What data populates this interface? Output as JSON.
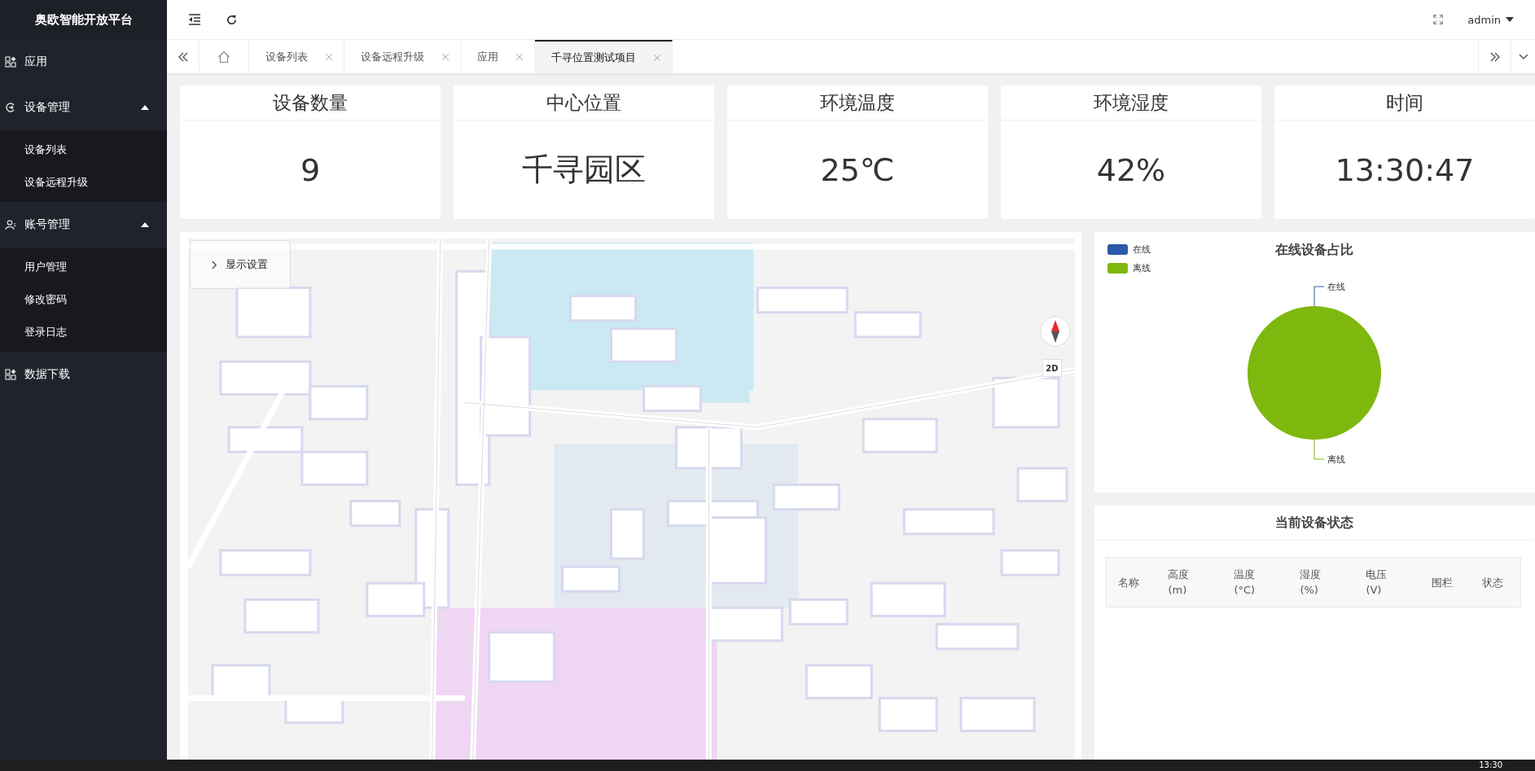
{
  "sidebar": {
    "title": "奥欧智能开放平台",
    "items": [
      {
        "label": "应用",
        "kind": "link"
      },
      {
        "label": "设备管理",
        "kind": "group",
        "expanded": true,
        "children": [
          {
            "label": "设备列表"
          },
          {
            "label": "设备远程升级"
          }
        ]
      },
      {
        "label": "账号管理",
        "kind": "group",
        "expanded": true,
        "children": [
          {
            "label": "用户管理"
          },
          {
            "label": "修改密码"
          },
          {
            "label": "登录日志"
          }
        ]
      },
      {
        "label": "数据下载",
        "kind": "link"
      }
    ]
  },
  "header": {
    "user": "admin"
  },
  "tabs": [
    {
      "label": "设备列表",
      "selected": false
    },
    {
      "label": "设备远程升级",
      "selected": false
    },
    {
      "label": "应用",
      "selected": false
    },
    {
      "label": "千寻位置测试项目",
      "selected": true
    }
  ],
  "stats": [
    {
      "title": "设备数量",
      "value": "9"
    },
    {
      "title": "中心位置",
      "value": "千寻园区"
    },
    {
      "title": "环境温度",
      "value": "25℃"
    },
    {
      "title": "环境湿度",
      "value": "42%"
    },
    {
      "title": "时间",
      "value": "13:30:47"
    }
  ],
  "map": {
    "settings_label": "显示设置",
    "view_mode": "2D"
  },
  "pie_panel": {
    "legend": [
      {
        "label": "在线",
        "color": "#2c5aa8"
      },
      {
        "label": "离线",
        "color": "#7eb80e"
      }
    ],
    "title": "在线设备占比",
    "slice_labels": [
      "在线",
      "离线"
    ]
  },
  "status_panel": {
    "title": "当前设备状态",
    "columns": [
      "名称",
      "高度 (m)",
      "温度 (°C)",
      "湿度 (%)",
      "电压 (V)",
      "围栏",
      "状态"
    ]
  },
  "taskbar": {
    "time": "13:30"
  }
}
